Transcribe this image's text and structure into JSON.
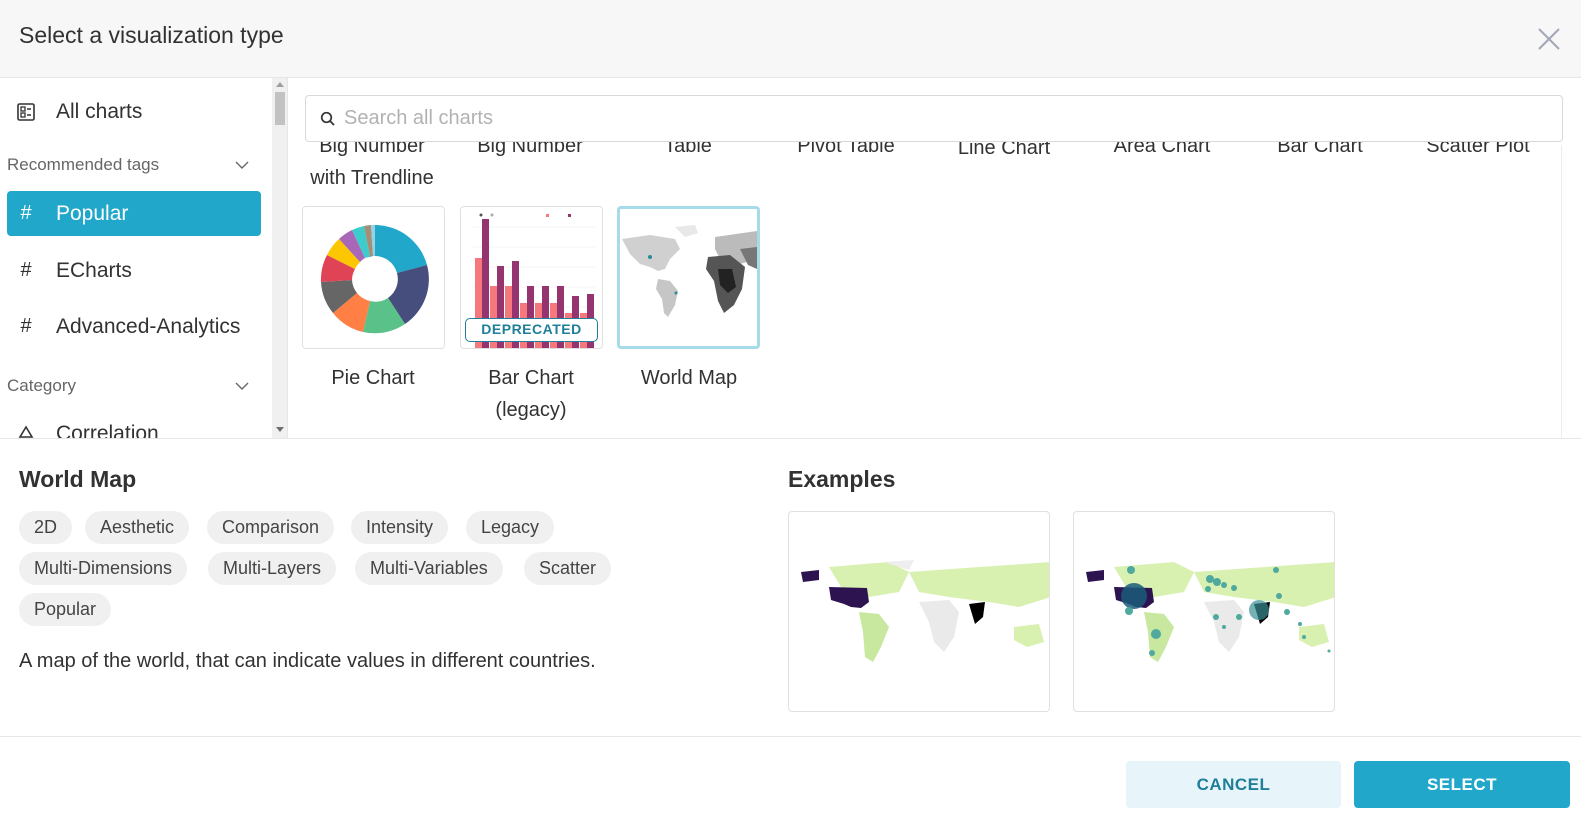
{
  "modal": {
    "title": "Select a visualization type",
    "close_icon": "close-icon"
  },
  "sidebar": {
    "all_charts": {
      "label": "All charts",
      "icon": "chart-list-icon"
    },
    "recommended_section": "Recommended tags",
    "tags": [
      {
        "label": "Popular",
        "icon": "hash-icon",
        "active": true
      },
      {
        "label": "ECharts",
        "icon": "hash-icon",
        "active": false
      },
      {
        "label": "Advanced-Analytics",
        "icon": "hash-icon",
        "active": false
      }
    ],
    "category_section": "Category",
    "categories": [
      {
        "label": "Correlation",
        "icon": "correlation-icon"
      }
    ]
  },
  "search": {
    "placeholder": "Search all charts",
    "value": ""
  },
  "gallery": {
    "top_row_labels": [
      "Big Number with Trendline",
      "Big Number",
      "Table",
      "Pivot Table",
      "Line Chart",
      "Area Chart",
      "Bar Chart",
      "Scatter Plot"
    ],
    "top_row_visible_first": "Big Number",
    "top_row_visible_second": "with Trendline",
    "items": [
      {
        "label_line1": "Pie Chart",
        "label_line2": "",
        "badge": "",
        "selected": false
      },
      {
        "label_line1": "Bar Chart",
        "label_line2": "(legacy)",
        "badge": "DEPRECATED",
        "selected": false
      },
      {
        "label_line1": "World Map",
        "label_line2": "",
        "badge": "",
        "selected": true
      }
    ]
  },
  "details": {
    "title": "World Map",
    "tags": [
      "2D",
      "Aesthetic",
      "Comparison",
      "Intensity",
      "Legacy",
      "Multi-Dimensions",
      "Multi-Layers",
      "Multi-Variables",
      "Scatter",
      "Popular"
    ],
    "description": "A map of the world, that can indicate values in different countries.",
    "examples_title": "Examples"
  },
  "footer": {
    "cancel_label": "CANCEL",
    "select_label": "SELECT"
  },
  "colors": {
    "accent": "#20a7c9",
    "accent_dark": "#1f7f99",
    "cancel_bg": "#e7f5fa",
    "selected_border": "#a8dbea",
    "tag_bg": "#f0f0f0"
  }
}
